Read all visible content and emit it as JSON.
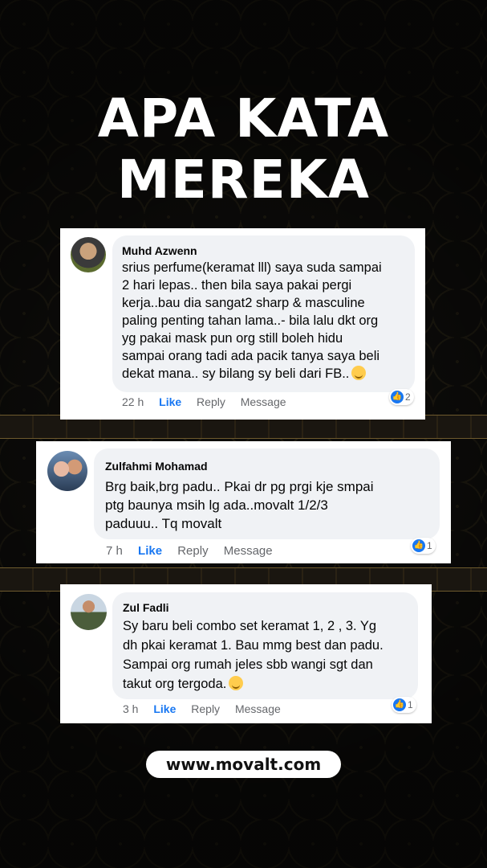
{
  "headline": {
    "line1": "APA KATA",
    "line2": "MEREKA"
  },
  "comments": [
    {
      "name": "Muhd Azwenn",
      "lines": [
        "srius perfume(keramat lll) saya suda sampai",
        "2 hari lepas.. then bila saya pakai pergi",
        "kerja..bau dia sangat2 sharp & masculine",
        "paling penting tahan lama..- bila lalu dkt org",
        "yg pakai mask pun org still boleh hidu",
        "sampai orang  tadi ada pacik tanya saya beli",
        "dekat mana.. sy bilang sy beli dari FB.."
      ],
      "emoji": "smiling-face-icon",
      "time": "22 h",
      "like": "Like",
      "reply": "Reply",
      "message": "Message",
      "reaction_count": "2"
    },
    {
      "name": "Zulfahmi Mohamad",
      "lines": [
        "Brg baik,brg padu.. Pkai dr pg prgi kje smpai",
        "ptg baunya msih lg ada..movalt 1/2/3",
        "paduuu.. Tq movalt"
      ],
      "time": "7 h",
      "like": "Like",
      "reply": "Reply",
      "message": "Message",
      "reaction_count": "1"
    },
    {
      "name": "Zul Fadli",
      "lines": [
        "Sy baru beli combo set keramat 1, 2 , 3. Yg",
        "dh pkai keramat 1. Bau mmg best dan padu.",
        "Sampai org rumah jeles sbb wangi sgt dan",
        "takut org tergoda."
      ],
      "emoji": "laughing-face-icon",
      "time": "3 h",
      "like": "Like",
      "reply": "Reply",
      "message": "Message",
      "reaction_count": "1"
    }
  ],
  "website": "www.movalt.com",
  "colors": {
    "like_blue": "#1877f2",
    "bubble_gray": "#f0f2f5",
    "background": "#0d0c0a",
    "gold": "#6e5a2e"
  }
}
